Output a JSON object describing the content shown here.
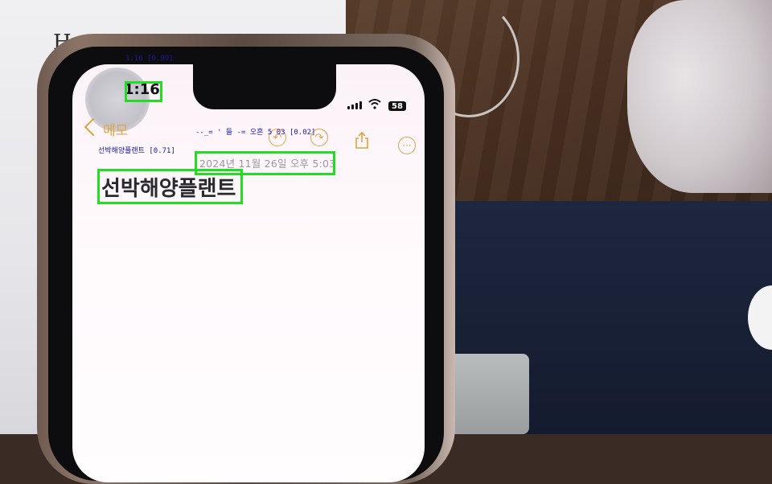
{
  "background": {
    "paper_letter": "H"
  },
  "phone": {
    "status_bar": {
      "time": "1:16",
      "battery": "58"
    },
    "nav": {
      "back_label": "메모"
    },
    "note": {
      "date": "2024년 11월 26일 오후 5:03",
      "title": "선박해양플랜트"
    }
  },
  "ocr": {
    "labels": [
      {
        "text": "1:16 [0.99]"
      },
      {
        "text": "--_= ' 들 -= 오흔 5 03 [0.02]"
      },
      {
        "text": "선박해양플랜트 [0.71]"
      }
    ],
    "box_color": "#22dd22",
    "label_color": "#1a1aa0"
  },
  "colors": {
    "accent": "#e0a640",
    "screen_bg": "#fbf2f7"
  }
}
